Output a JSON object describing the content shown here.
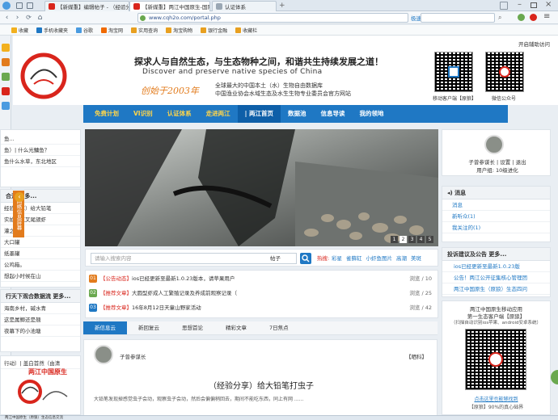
{
  "browser": {
    "tabs": [
      {
        "title": "【新媒重】编辑帖子 - （经验分享）",
        "active": false
      },
      {
        "title": "【新媒重】两江中国原生-国际...",
        "active": true
      },
      {
        "title": "认证体系",
        "active": false
      }
    ],
    "url": "www.cqh2o.com/portal.php",
    "search_engine_label": "极速",
    "bookmarks": [
      "收藏",
      "手机收藏夹",
      "谷歌",
      "淘宝网",
      "实用查询",
      "淘宝购物",
      "银行金融",
      "收藏栏"
    ]
  },
  "header": {
    "top_right_link": "开启辅助访问",
    "slogan_cn": "探求人与自然生态，与生态物种之间，和谐共生持续发展之道！",
    "slogan_en": "Discover and preserve native species of China",
    "founded": "创始于2003年",
    "desc1": "全球最大的中国本土（水）生物自由数据库",
    "desc2": "中国渔业协会水域生态及水生生物专业委员会官方网站",
    "qr1_label": "移动客户端【原狼】",
    "qr2_label": "微信公众号"
  },
  "nav": {
    "items": [
      {
        "label": "免费计划",
        "style": "yellow"
      },
      {
        "label": "VI识别",
        "style": "yellow"
      },
      {
        "label": "认证体系",
        "style": "yellow"
      },
      {
        "label": "走进两江",
        "style": "yellow"
      },
      {
        "label": "| 两江首页",
        "style": "selected"
      },
      {
        "label": "数据池",
        "style": "white"
      },
      {
        "label": "信息导读",
        "style": "white"
      },
      {
        "label": "我的领地",
        "style": "white"
      }
    ]
  },
  "left": {
    "block1": [
      "鱼...",
      "鱼）| 什么光鳙鱼？",
      "鱼什么水草，东北地区"
    ],
    "block2_title": "合流 更多...",
    "block2": [
      "经验分享）给大铅笔",
      "实拍斑点叉尾颌虾",
      "灌之间...",
      "大口罐",
      "纸墨罐",
      "公鸡箱。",
      "想起小时候在山"
    ],
    "side_tab": "网络信息屏幕",
    "block3_title": "行天下观合数据流 更多...",
    "block3": [
      "海南乡村，碱水青",
      "这是属鲫还是翘",
      "夜幕下的小池塘"
    ],
    "block4_title": "行动）| 盖白首然（由清",
    "logo_text": "两江中国原生"
  },
  "photo": {
    "pages": [
      "1",
      "2",
      "3",
      "4",
      "5"
    ],
    "current_page": "2"
  },
  "search": {
    "placeholder": "请输入搜索内容",
    "type": "帖子",
    "hot_label": "热搜:",
    "hot_terms": [
      "彩星",
      "雀藓缸",
      "小虾鱼图片",
      "高潮",
      "美斑"
    ]
  },
  "news": [
    {
      "num": "01",
      "color": "#e27b1c",
      "tag": "【公告动态】",
      "text": "ios已经更新至最新1.0.23版本，请苹果用户",
      "stat": "浏览 / 10"
    },
    {
      "num": "02",
      "color": "#6aa84f",
      "tag": "【推荐文章】",
      "text": "大圆型虾成人工繁殖记录及养成前观察记录（",
      "stat": "浏览 / 25"
    },
    {
      "num": "03",
      "color": "#1f78c4",
      "tag": "【推荐文章】",
      "text": "16年8月12日天童山野家活动",
      "stat": "浏览 / 42"
    }
  ],
  "tabs2": [
    "新信息云",
    "新回复云",
    "思想首论",
    "精彩文章",
    "7日焦点"
  ],
  "card": {
    "user": "子曾参谋长",
    "badge": "【晒科】",
    "title": "（经验分享）给大铅笔打虫子",
    "excerpt": "大铅笔发现掉感觉虫子会动，观察虫子会动，然后会偏偏稍回去，期间不能吃东西，同上有网 ......"
  },
  "right": {
    "user": "子曾参谋长",
    "links": [
      "设置",
      "退出"
    ],
    "group": "用户组: 10级进化",
    "msg_title": "消息",
    "msgs": [
      "消息",
      "新听众(1)",
      "我关注的(1)"
    ],
    "ann_title": "投诉建议及公告 更多...",
    "anns": [
      "ios已经更新至最新1.0.23版",
      "公告！两江公开征集核心管理团",
      "两江中国原生（原狼）生态四问"
    ],
    "app_title": "两江中国原生移动应用",
    "app_line2": "第一生态客户端【原狼】",
    "app_line3": "（扫描自动识别ios苹果、android安卓系统）",
    "app_link": "点击这里也能够找到",
    "app_note": "【原狼】90%的真心础界"
  },
  "status": {
    "text": "两江中国原生（原狼）生态信息交流"
  }
}
